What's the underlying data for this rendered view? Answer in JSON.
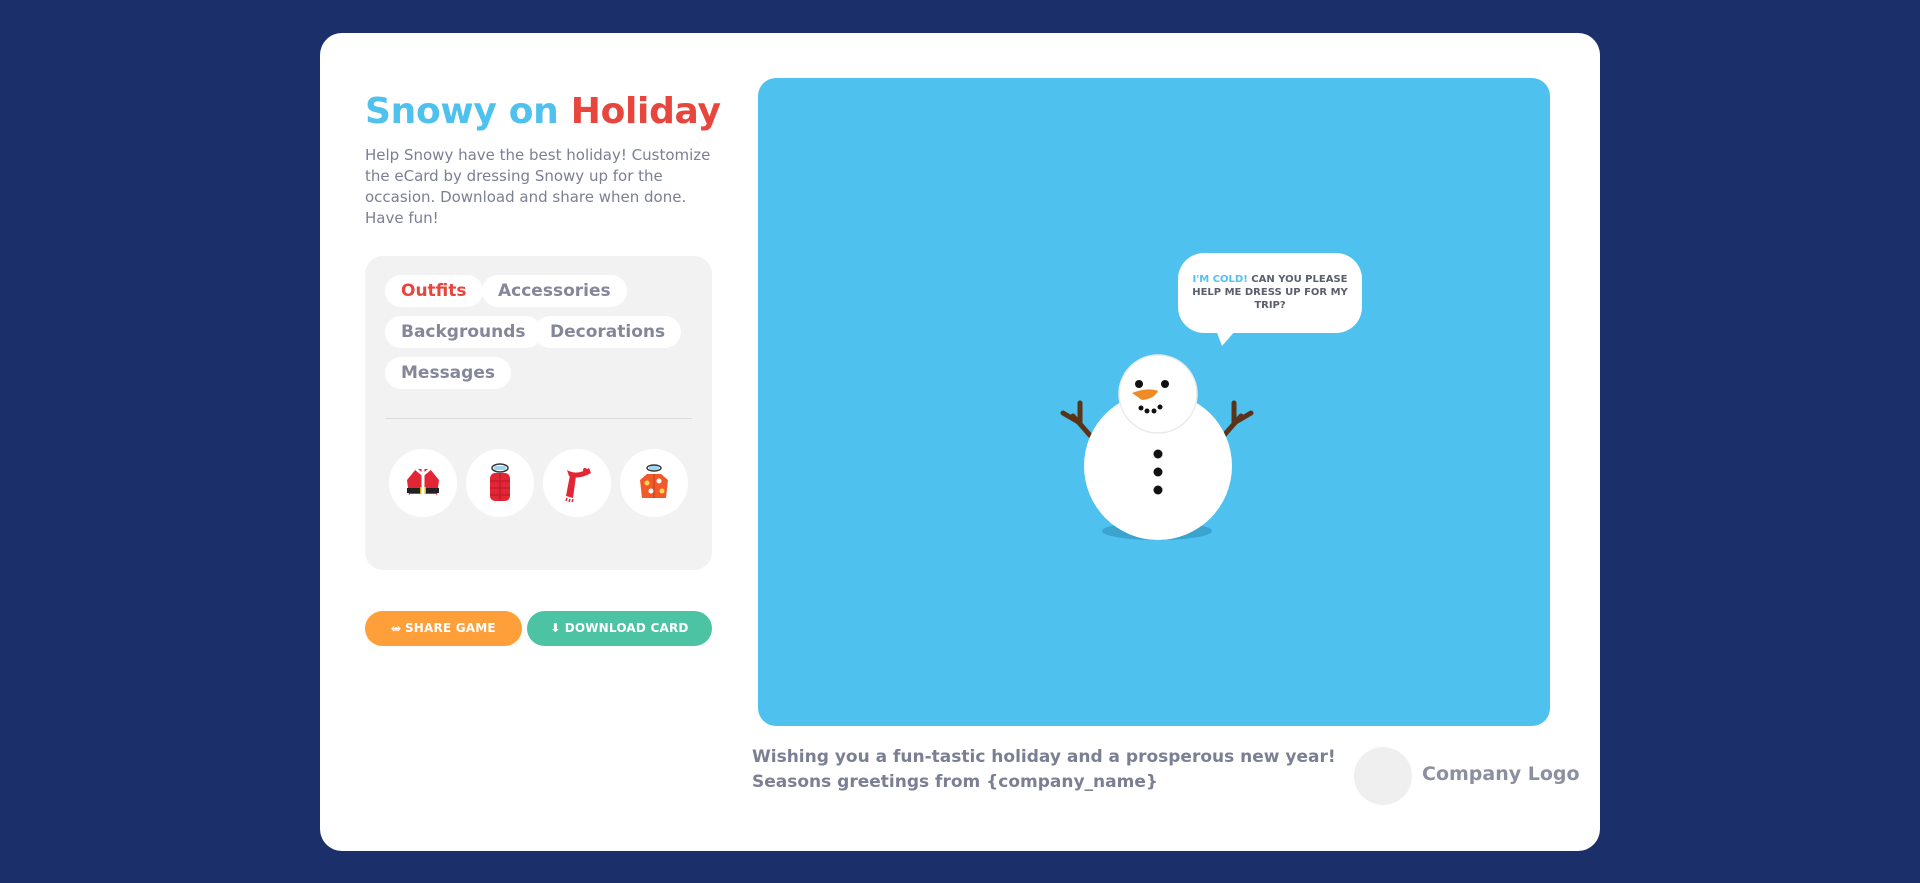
{
  "title": {
    "part1": "Snowy on",
    "part2": "Holiday"
  },
  "intro": "Help Snowy have the best holiday! Customize the eCard by dressing Snowy up for the occasion. Download and share when done. Have fun!",
  "tabs": [
    {
      "label": "Outfits",
      "active": true
    },
    {
      "label": "Accessories"
    },
    {
      "label": "Backgrounds"
    },
    {
      "label": "Decorations"
    },
    {
      "label": "Messages"
    }
  ],
  "outfit_items": [
    "santa-coat-icon",
    "puffer-vest-icon",
    "scarf-icon",
    "hawaiian-shirt-icon"
  ],
  "buttons": {
    "share": "SHARE GAME",
    "download": "DOWNLOAD CARD"
  },
  "bubble": {
    "highlight": "I'M COLD!",
    "text": "CAN YOU PLEASE HELP ME DRESS UP FOR MY TRIP?"
  },
  "footer": {
    "line1": "Wishing you a fun-tastic holiday and a prosperous new year!",
    "line2": "Seasons greetings from {company_name}"
  },
  "company_logo": "Company Logo",
  "colors": {
    "page_bg": "#1b2f6b",
    "stage_bg": "#4fc1ee",
    "accent_red": "#e8453c",
    "accent_blue": "#4fc1ee",
    "share_btn": "#ff9f3a",
    "download_btn": "#4cc3a3"
  }
}
